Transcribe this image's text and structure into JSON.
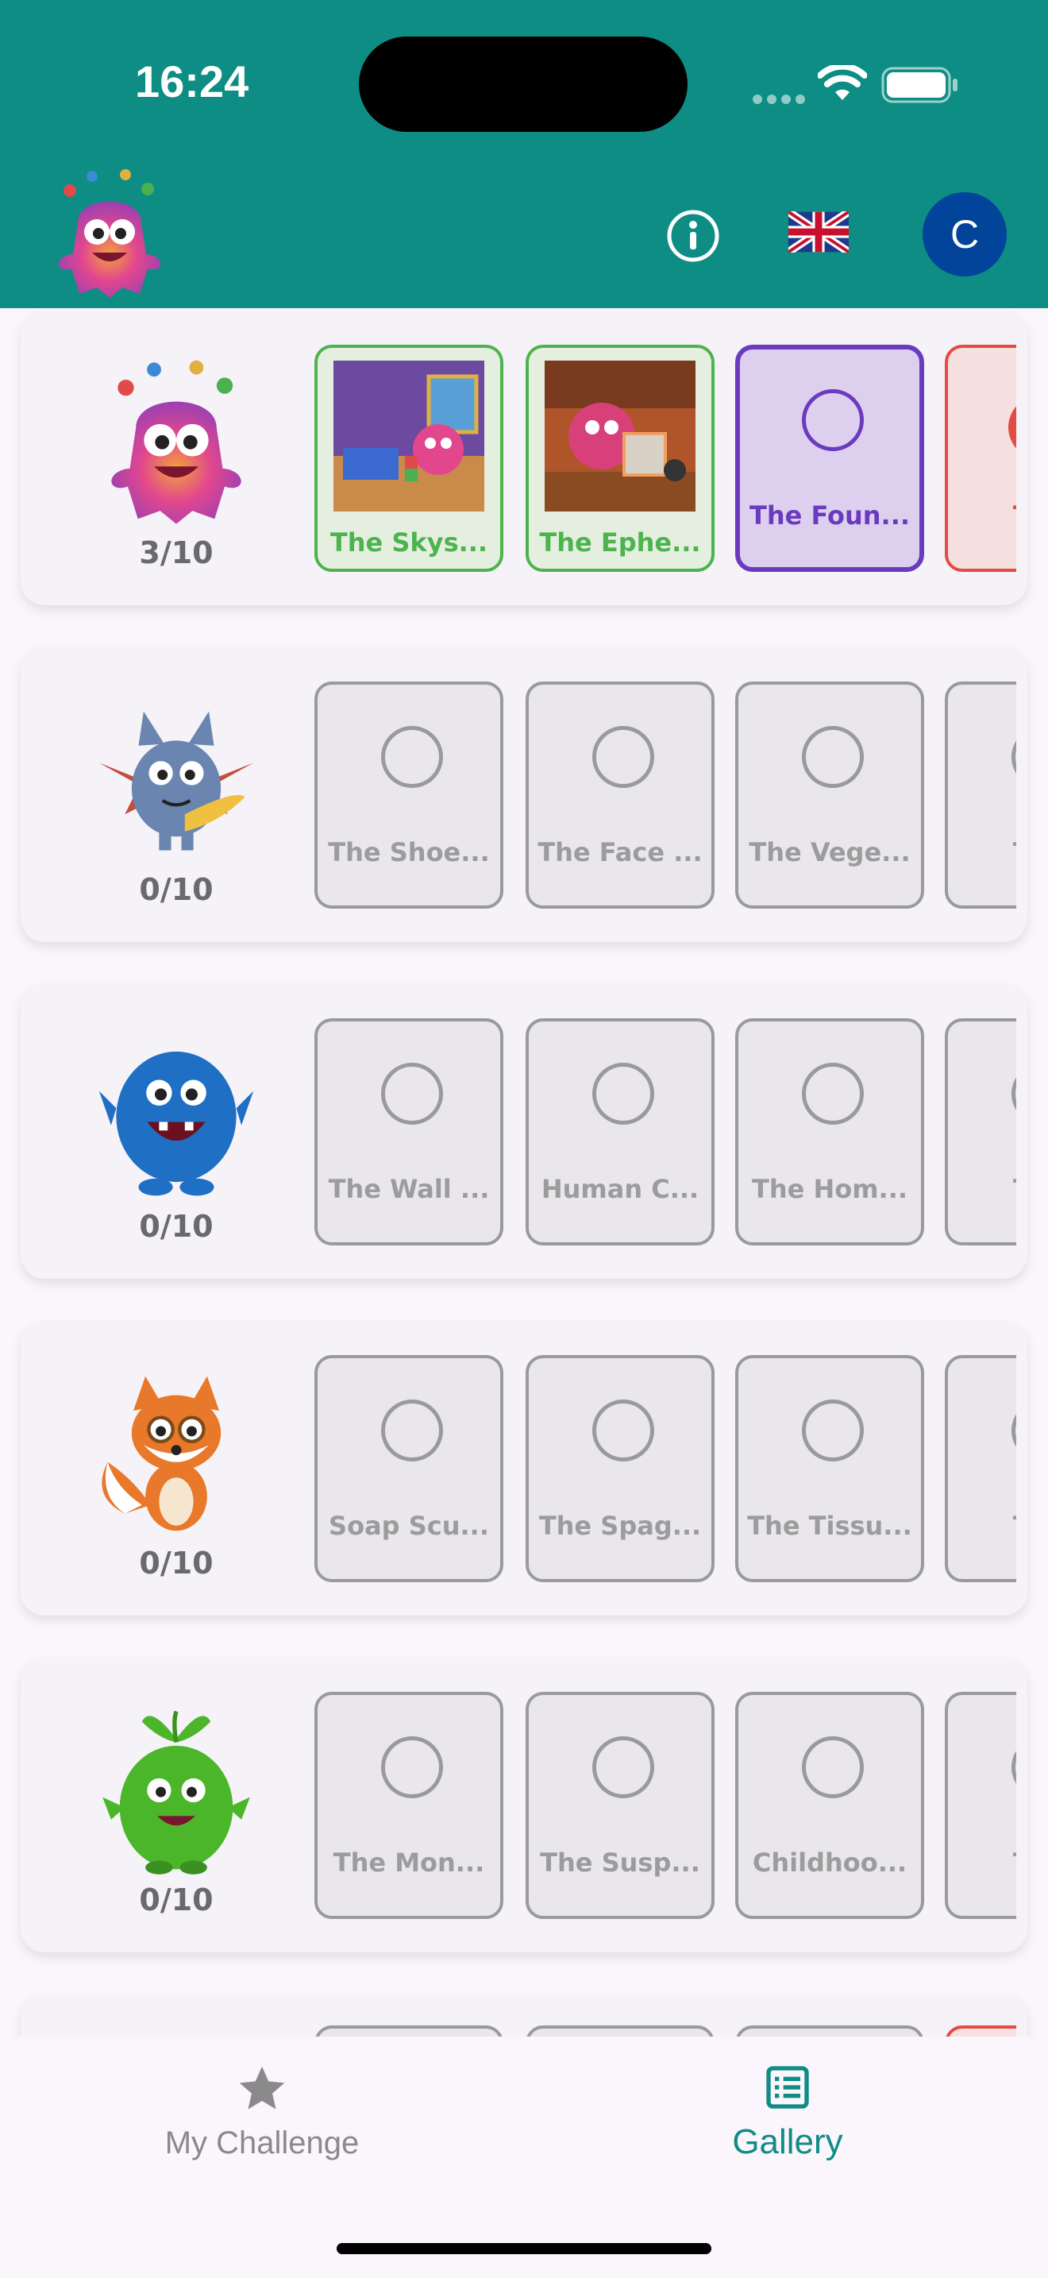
{
  "status_bar": {
    "time": "16:24"
  },
  "header": {
    "logo_icon": "juggling-monster-logo",
    "info_icon": "info-icon",
    "language_icon": "uk-flag-icon",
    "avatar_letter": "C",
    "colors": {
      "header_bg": "#0d8d84",
      "avatar_bg": "#01449a"
    }
  },
  "challenges": [
    {
      "character": "pink-juggling-monster",
      "progress": "3/10",
      "stories": [
        {
          "title": "The Skys...",
          "state": "done"
        },
        {
          "title": "The Ephe...",
          "state": "done"
        },
        {
          "title": "The Foun...",
          "state": "current"
        },
        {
          "title": "The",
          "state": "failed"
        }
      ]
    },
    {
      "character": "blue-bat-monster",
      "progress": "0/10",
      "stories": [
        {
          "title": "The Shoe...",
          "state": "locked"
        },
        {
          "title": "The Face ...",
          "state": "locked"
        },
        {
          "title": "The Vege...",
          "state": "locked"
        },
        {
          "title": "The",
          "state": "locked"
        }
      ]
    },
    {
      "character": "blue-fluffy-monster",
      "progress": "0/10",
      "stories": [
        {
          "title": "The Wall ...",
          "state": "locked"
        },
        {
          "title": "Human C...",
          "state": "locked"
        },
        {
          "title": "The Hom...",
          "state": "locked"
        },
        {
          "title": "The",
          "state": "locked"
        }
      ]
    },
    {
      "character": "fox-with-glasses",
      "progress": "0/10",
      "stories": [
        {
          "title": "Soap Scu...",
          "state": "locked"
        },
        {
          "title": "The Spag...",
          "state": "locked"
        },
        {
          "title": "The Tissu...",
          "state": "locked"
        },
        {
          "title": "The",
          "state": "locked"
        }
      ]
    },
    {
      "character": "green-sprout-monster",
      "progress": "0/10",
      "stories": [
        {
          "title": "The Mon...",
          "state": "locked"
        },
        {
          "title": "The Susp...",
          "state": "locked"
        },
        {
          "title": "Childhoo...",
          "state": "locked"
        },
        {
          "title": "The",
          "state": "locked"
        }
      ]
    }
  ],
  "bottom_nav": {
    "items": [
      {
        "label": "My Challenge",
        "icon": "star-icon",
        "active": false
      },
      {
        "label": "Gallery",
        "icon": "list-icon",
        "active": true
      }
    ]
  }
}
